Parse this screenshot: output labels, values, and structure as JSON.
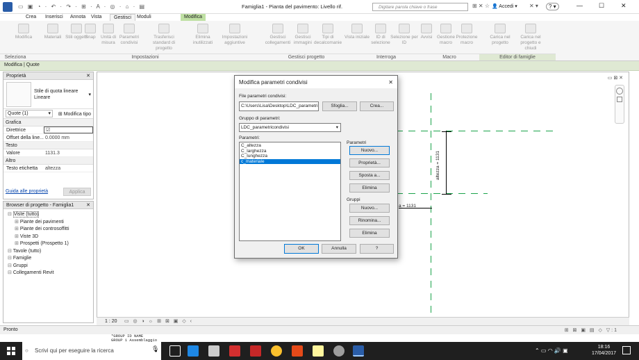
{
  "window": {
    "title": "Famiglia1 - Pianta del pavimento: Livello rif.",
    "search_placeholder": "Digitare parola chiave o frase",
    "signin": "Accedi",
    "help": "?"
  },
  "tabs": [
    "Crea",
    "Inserisci",
    "Annota",
    "Vista",
    "Gestisci",
    "Moduli aggiuntivi",
    "Modifica | Quote"
  ],
  "ribbon": {
    "buttons": [
      {
        "label": "Modifica"
      },
      {
        "label": "Materiali"
      },
      {
        "label": "Stili oggetti"
      },
      {
        "label": "Snap"
      },
      {
        "label": "Unità di misura"
      },
      {
        "label": "Parametri condivisi"
      },
      {
        "label": "Trasferisci standard di progetto"
      },
      {
        "label": "Elimina inutilizzati"
      },
      {
        "label": "Impostazioni aggiuntive"
      },
      {
        "label": "Gestisci collegamenti"
      },
      {
        "label": "Gestisci immagini"
      },
      {
        "label": "Tipi di decalcomanie"
      },
      {
        "label": "Vista iniziale"
      },
      {
        "label": "ID di selezione"
      },
      {
        "label": "Selezione per ID"
      },
      {
        "label": "Avvisi"
      },
      {
        "label": "Gestione macro"
      },
      {
        "label": "Protezione macro"
      },
      {
        "label": "Carica nel progetto"
      },
      {
        "label": "Carica nel progetto e chiudi"
      }
    ],
    "groups": [
      "Seleziona",
      "Impostazioni",
      "Gestisci progetto",
      "Interroga",
      "Macro",
      "Editor di famiglie"
    ]
  },
  "context_bar": "Modifica | Quote",
  "properties": {
    "title": "Proprietà",
    "type_name": "Stile di quota lineare Lineare",
    "instance_filter": "Quote (1)",
    "edit_type": "Modifica tipo",
    "categories": [
      {
        "name": "Grafica",
        "rows": [
          {
            "k": "Direttrice",
            "v": "☑"
          },
          {
            "k": "Offset della line...",
            "v": "0.0000 mm"
          }
        ]
      },
      {
        "name": "Testo",
        "rows": [
          {
            "k": "Valore",
            "v": "1131.3"
          }
        ]
      },
      {
        "name": "Altro",
        "rows": [
          {
            "k": "Testo etichetta",
            "v": "altezza"
          }
        ]
      }
    ],
    "help_link": "Guida alle proprietà",
    "apply": "Applica"
  },
  "browser": {
    "title": "Browser di progetto - Famiglia1",
    "items": [
      {
        "label": "Viste (tutto)",
        "indent": 0
      },
      {
        "label": "Piante dei pavimenti",
        "indent": 1
      },
      {
        "label": "Piante dei controsoffitti",
        "indent": 1
      },
      {
        "label": "Viste 3D",
        "indent": 1
      },
      {
        "label": "Prospetti (Prospetto 1)",
        "indent": 1
      },
      {
        "label": "Tavole (tutto)",
        "indent": 0
      },
      {
        "label": "Famiglie",
        "indent": 0
      },
      {
        "label": "Gruppi",
        "indent": 0
      },
      {
        "label": "Collegamenti Revit",
        "indent": 0
      }
    ]
  },
  "canvas": {
    "dim_vertical": "altezza = 1131",
    "dim_horizontal": "a = 1131",
    "scale": "1 : 20"
  },
  "dialog": {
    "title": "Modifica parametri condivisi",
    "file_label": "File parametri condivisi:",
    "file_path": "C:\\Users\\Lisa\\Desktop\\LDC_parametri c(",
    "browse": "Sfoglia...",
    "create": "Crea...",
    "group_label": "Gruppo di parametri:",
    "group_value": "LDC_parametricondivisi",
    "params_label": "Parametri:",
    "params": [
      "C_altezza",
      "C_larghezza",
      "C_lunghezza",
      "c_materiale"
    ],
    "params_section": "Parametri",
    "param_buttons": [
      "Nuovo...",
      "Proprietà...",
      "Sposta a...",
      "Elimina"
    ],
    "groups_section": "Gruppi",
    "group_buttons": [
      "Nuovo...",
      "Rinomina...",
      "Elimina"
    ],
    "ok": "OK",
    "cancel": "Annulla",
    "help": "?"
  },
  "status": "Pronto",
  "console": [
    "*GROUP  ID      NAME",
    "GROUP   1       Assemblaggio"
  ],
  "taskbar": {
    "search_placeholder": "Scrivi qui per eseguire la ricerca",
    "time": "18:16",
    "date": "17/04/2017"
  }
}
